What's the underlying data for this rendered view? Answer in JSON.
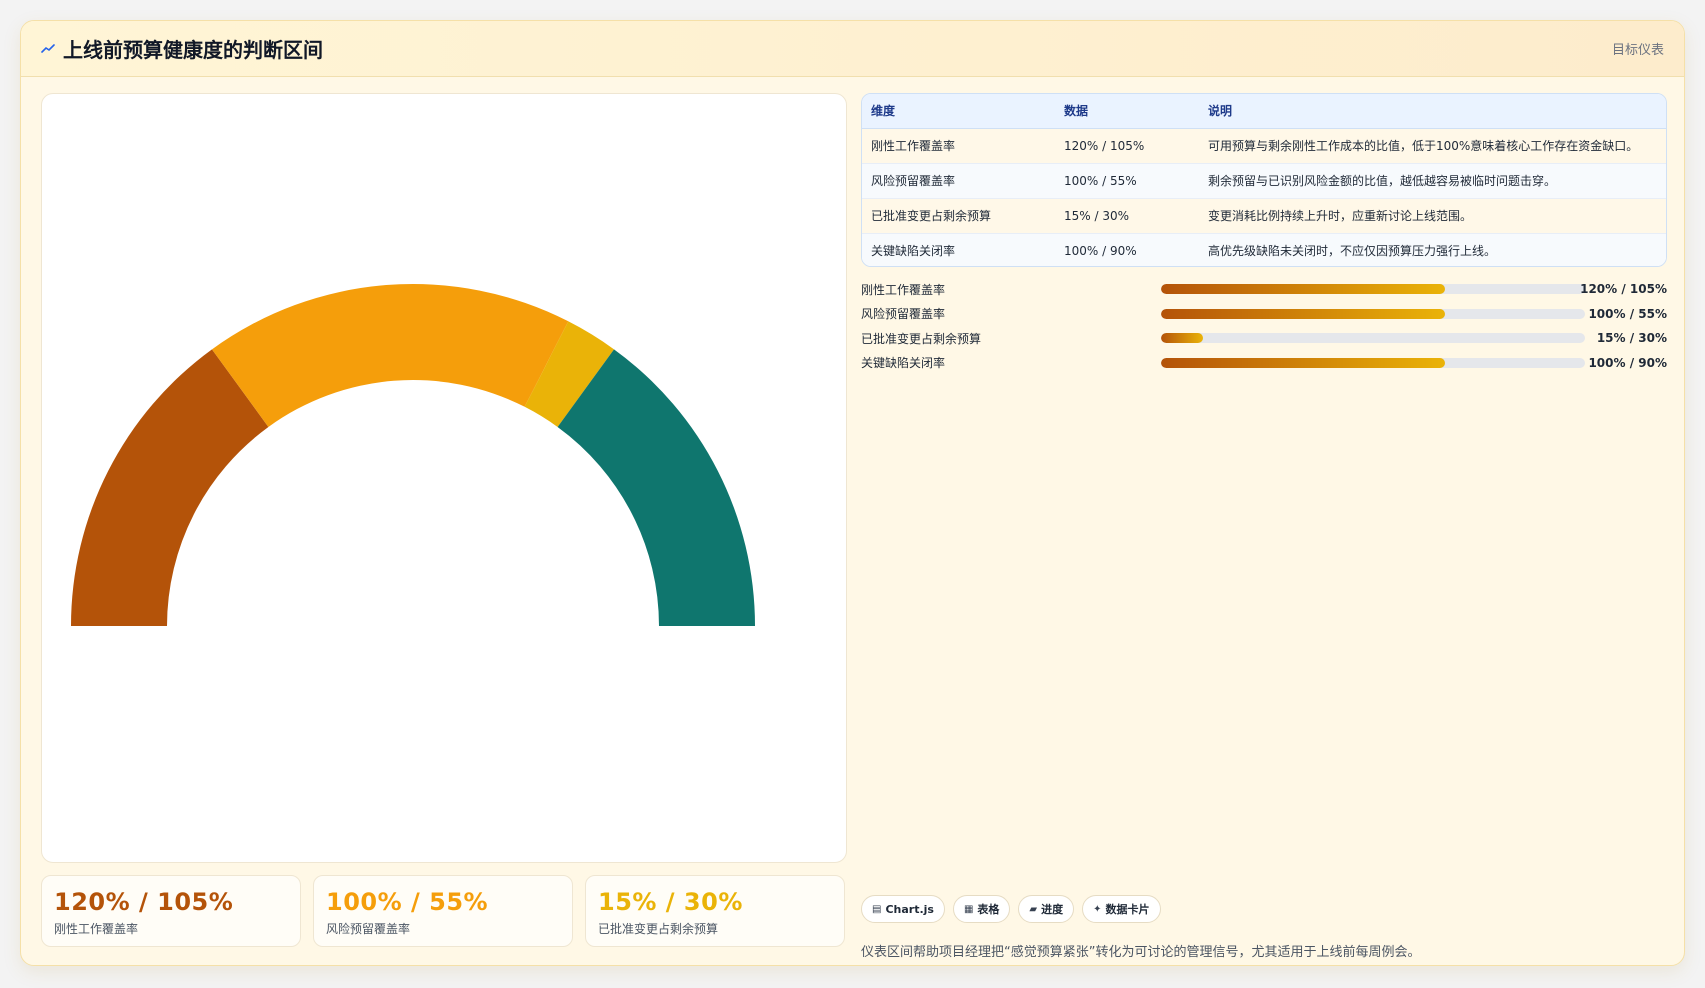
{
  "header": {
    "title": "上线前预算健康度的判断区间",
    "tag": "目标仪表",
    "icon": "trend-line-icon"
  },
  "chart_data": {
    "type": "gauge",
    "segments": [
      {
        "value": 30,
        "color": "#b45309"
      },
      {
        "value": 35,
        "color": "#f59e0b"
      },
      {
        "value": 5,
        "color": "#eab308"
      },
      {
        "value": 30,
        "color": "#0f766e"
      }
    ]
  },
  "kpis": [
    {
      "value": "120% / 105%",
      "label": "刚性工作覆盖率",
      "color": "#b45309"
    },
    {
      "value": "100% / 55%",
      "label": "风险预留覆盖率",
      "color": "#f59e0b"
    },
    {
      "value": "15% / 30%",
      "label": "已批准变更占剩余预算",
      "color": "#eab308"
    }
  ],
  "table": {
    "headers": [
      "维度",
      "数据",
      "说明"
    ],
    "rows": [
      {
        "dim": "刚性工作覆盖率",
        "data": "120% / 105%",
        "desc": "可用预算与剩余刚性工作成本的比值，低于100%意味着核心工作存在资金缺口。"
      },
      {
        "dim": "风险预留覆盖率",
        "data": "100% / 55%",
        "desc": "剩余预留与已识别风险金额的比值，越低越容易被临时问题击穿。"
      },
      {
        "dim": "已批准变更占剩余预算",
        "data": "15% / 30%",
        "desc": "变更消耗比例持续上升时，应重新讨论上线范围。"
      },
      {
        "dim": "关键缺陷关闭率",
        "data": "100% / 90%",
        "desc": "高优先级缺陷未关闭时，不应仅因预算压力强行上线。"
      }
    ]
  },
  "bars": [
    {
      "label": "刚性工作覆盖率",
      "value": "120% / 105%",
      "fill": 0.67
    },
    {
      "label": "风险预留覆盖率",
      "value": "100% / 55%",
      "fill": 0.67
    },
    {
      "label": "已批准变更占剩余预算",
      "value": "15% / 30%",
      "fill": 0.1
    },
    {
      "label": "关键缺陷关闭率",
      "value": "100% / 90%",
      "fill": 0.67
    }
  ],
  "chips": [
    {
      "icon": "chart-icon",
      "glyph": "▤",
      "label": "Chart.js"
    },
    {
      "icon": "table-icon",
      "glyph": "▦",
      "label": "表格"
    },
    {
      "icon": "progress-icon",
      "glyph": "▰",
      "label": "进度"
    },
    {
      "icon": "data-card-icon",
      "glyph": "✦",
      "label": "数据卡片"
    }
  ],
  "note": "仪表区间帮助项目经理把“感觉预算紧张”转化为可讨论的管理信号，尤其适用于上线前每周例会。"
}
